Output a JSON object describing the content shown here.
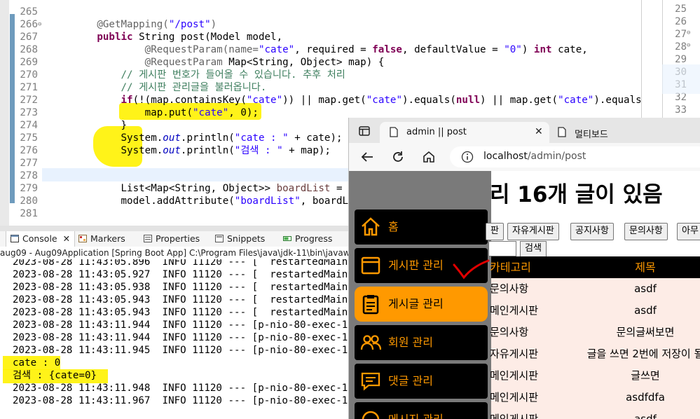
{
  "editor": {
    "lines": [
      {
        "n": "265"
      },
      {
        "n": "266",
        "ann": "@GetMapping(",
        "str": "\"/post\"",
        "end": ")"
      },
      {
        "n": "267"
      },
      {
        "n": "268"
      },
      {
        "n": "269"
      },
      {
        "n": "270",
        "comment": "// 게시판 번호가 들어올 수 있습니다. 추후 처리"
      },
      {
        "n": "271",
        "comment": "// 게시판 관리글을 불러옵니다."
      },
      {
        "n": "272"
      },
      {
        "n": "273"
      },
      {
        "n": "274",
        "text": "}"
      },
      {
        "n": "275"
      },
      {
        "n": "276"
      },
      {
        "n": "277"
      },
      {
        "n": "278"
      },
      {
        "n": "279"
      },
      {
        "n": "280"
      },
      {
        "n": "281"
      }
    ],
    "l267": {
      "kw1": "public",
      "rest": " String post(Model model,"
    },
    "l268": {
      "ann": "@RequestParam(name=",
      "s1": "\"cate\"",
      "mid": ", required = ",
      "kw": "false",
      "mid2": ", defaultValue = ",
      "s2": "\"0\"",
      "mid3": ") ",
      "kw2": "int",
      "end": " cate,"
    },
    "l269": {
      "ann": "@RequestParam",
      "rest": " Map<String, Object> map) {"
    },
    "l272": {
      "kw": "if",
      "a": "(!(map.containsKey(",
      "s1": "\"cate\"",
      "b": ")) || map.get(",
      "s2": "\"cate\"",
      "c": ").equals(",
      "kw2": "null",
      "d": ") || map.get(",
      "s3": "\"cate\"",
      "e": ").equals(",
      "s4": "\"\"",
      "f": ")) {"
    },
    "l273": {
      "a": "map.put(",
      "s": "\"cate\"",
      "b": ", 0);"
    },
    "l275": {
      "a": "System.",
      "f": "out",
      "b": ".println(",
      "s": "\"cate : \"",
      "c": " + cate);"
    },
    "l276": {
      "a": "System.",
      "f": "out",
      "b": ".println(",
      "s": "\"검색 : \"",
      "c": " + map);"
    },
    "l279": {
      "a": "List<Map<String, Object>> ",
      "v": "boardList",
      "b": " = admi"
    },
    "l280": {
      "a": "model.addAttribute(",
      "s": "\"boardList\"",
      "b": ", boardList)"
    }
  },
  "editor2": {
    "lines": [
      "25",
      "26",
      "27",
      "28",
      "29",
      "30",
      "31",
      "32",
      "33"
    ]
  },
  "console_tabs": {
    "console": "Console",
    "markers": "Markers",
    "properties": "Properties",
    "snippets": "Snippets",
    "progress": "Progress"
  },
  "console": {
    "title": "aug09 - Aug09Application [Spring Boot App] C:\\Program Files\\java\\jdk-11\\bin\\javaw",
    "lines": [
      "2023-08-28 11:43:05.896  INFO 11120 --- [  restartedMain] o.",
      "2023-08-28 11:43:05.927  INFO 11120 --- [  restartedMain] o.",
      "2023-08-28 11:43:05.938  INFO 11120 --- [  restartedMain] o.",
      "2023-08-28 11:43:05.943  INFO 11120 --- [  restartedMain] co",
      "2023-08-28 11:43:05.943  INFO 11120 --- [  restartedMain] .C",
      "2023-08-28 11:43:11.944  INFO 11120 --- [p-nio-80-exec-1] o.",
      "2023-08-28 11:43:11.944  INFO 11120 --- [p-nio-80-exec-1] o.",
      "2023-08-28 11:43:11.945  INFO 11120 --- [p-nio-80-exec-1] o.",
      "cate : 0",
      "검색 : {cate=0}",
      "",
      "2023-08-28 11:43:11.948  INFO 11120 --- [p-nio-80-exec-1] co",
      "2023-08-28 11:43:11.967  INFO 11120 --- [p-nio-80-exec-1] co"
    ]
  },
  "browser": {
    "tab_title": "admin || post",
    "tab2_title": "멀티보드",
    "url_host": "localhost",
    "url_path": "/admin/post",
    "close": "✕"
  },
  "admin": {
    "menu": [
      {
        "label": "홈",
        "icon": "home-icon"
      },
      {
        "label": "게시판 관리",
        "icon": "window-icon"
      },
      {
        "label": "게시글 관리",
        "icon": "clipboard-icon"
      },
      {
        "label": "회원 관리",
        "icon": "users-icon"
      },
      {
        "label": "댓글 관리",
        "icon": "comment-icon"
      },
      {
        "label": "메시지 관리",
        "icon": "message-icon"
      }
    ],
    "heading": "리 16개 글이 있음",
    "filters": [
      "판",
      "자유게시판",
      "공지사항",
      "문의사항",
      "아무"
    ],
    "search_label": "검색",
    "columns": [
      "카테고리",
      "제목"
    ],
    "rows": [
      {
        "cat": "문의사항",
        "title": "asdf"
      },
      {
        "cat": "메인게시판",
        "title": "asdf"
      },
      {
        "cat": "문의사항",
        "title": "문의글써보면"
      },
      {
        "cat": "자유게시판",
        "title": "글을 쓰면 2번에 저장이 될"
      },
      {
        "cat": "메인게시판",
        "title": "글쓰면"
      },
      {
        "cat": "메인게시판",
        "title": "asdfdfa"
      },
      {
        "cat": "메인게시판",
        "title": "asdf"
      }
    ]
  },
  "colors": {
    "accent": "#ff9900",
    "highlight": "#fff200",
    "check_mark": "#e00000"
  }
}
